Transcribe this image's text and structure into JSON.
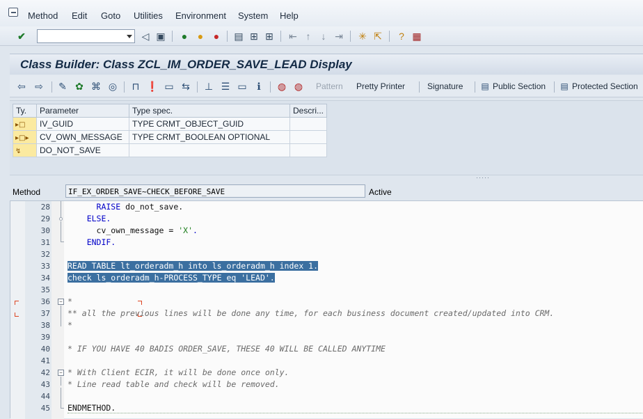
{
  "menu": [
    "Method",
    "Edit",
    "Goto",
    "Utilities",
    "Environment",
    "System",
    "Help"
  ],
  "standard_toolbar": {
    "command_field_value": "",
    "icons": [
      "enter-icon",
      "back-icon",
      "save-icon",
      "back-nav-icon",
      "exit-icon",
      "cancel-icon",
      "print-icon",
      "find-icon",
      "find-next-icon",
      "first-page-icon",
      "previous-page-icon",
      "next-page-icon",
      "last-page-icon",
      "new-session-icon",
      "shortcut-icon",
      "help-icon",
      "layout-icon"
    ]
  },
  "title": "Class Builder: Class ZCL_IM_ORDER_SAVE_LEAD Display",
  "app_toolbar": {
    "buttons": {
      "pattern": "Pattern",
      "pretty_printer": "Pretty Printer",
      "signature": "Signature",
      "public_section": "Public Section",
      "protected_section": "Protected Section"
    }
  },
  "parameters": {
    "headers": [
      "Ty.",
      "Parameter",
      "Type spec.",
      "Descri..."
    ],
    "rows": [
      {
        "ty": "importing",
        "parameter": "IV_GUID",
        "type_spec": "TYPE CRMT_OBJECT_GUID",
        "description": ""
      },
      {
        "ty": "changing",
        "parameter": "CV_OWN_MESSAGE",
        "type_spec": "TYPE CRMT_BOOLEAN OPTIONAL",
        "description": ""
      },
      {
        "ty": "exception",
        "parameter": "DO_NOT_SAVE",
        "type_spec": "",
        "description": ""
      }
    ]
  },
  "method_row": {
    "label": "Method",
    "value": "IF_EX_ORDER_SAVE~CHECK_BEFORE_SAVE",
    "status": "Active"
  },
  "editor": {
    "lines": [
      {
        "n": "28",
        "text": "      RAISE do_not_save."
      },
      {
        "n": "29",
        "text": "    ELSE."
      },
      {
        "n": "30",
        "text": "      cv_own_message = 'X'."
      },
      {
        "n": "31",
        "text": "    ENDIF."
      },
      {
        "n": "32",
        "text": ""
      },
      {
        "n": "33",
        "text": "READ TABLE lt_orderadm_h into ls_orderadm_h index 1."
      },
      {
        "n": "34",
        "text": "check ls_orderadm_h-PROCESS_TYPE eq 'LEAD'."
      },
      {
        "n": "35",
        "text": ""
      },
      {
        "n": "36",
        "text": "*"
      },
      {
        "n": "37",
        "text": "** all the previous lines will be done any time, for each business document created/updated into CRM."
      },
      {
        "n": "38",
        "text": "*"
      },
      {
        "n": "39",
        "text": ""
      },
      {
        "n": "40",
        "text": "* IF YOU HAVE 40 BADIS ORDER_SAVE, THESE 40 WILL BE CALLED ANYTIME"
      },
      {
        "n": "41",
        "text": ""
      },
      {
        "n": "42",
        "text": "* With Client ECIR, it will be done once only."
      },
      {
        "n": "43",
        "text": "* Line read table and check will be removed."
      },
      {
        "n": "44",
        "text": ""
      },
      {
        "n": "45",
        "text": "ENDMETHOD."
      }
    ]
  },
  "colors": {
    "selection": "#3b6fa0",
    "keyword": "#0000c8",
    "string": "#1b7d1b",
    "comment": "#6a6a6a",
    "title_text": "#132a45"
  }
}
